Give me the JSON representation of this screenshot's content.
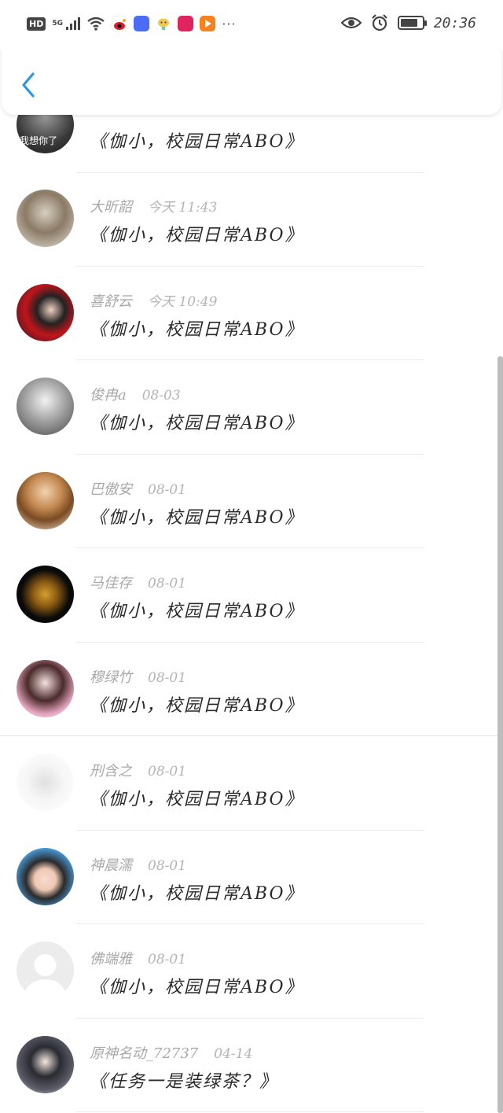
{
  "status_bar": {
    "hd": "HD",
    "network": "5G",
    "time": "20:36",
    "more": "···",
    "battery_level": 0.8,
    "icons": [
      "signal-icon",
      "wifi-icon",
      "weibo-icon",
      "app-blue-icon",
      "wechat-icon",
      "book-icon",
      "video-icon",
      "eye-icon",
      "alarm-icon",
      "battery-icon"
    ]
  },
  "header": {
    "back_icon": "chevron-left-icon"
  },
  "messages": [
    {
      "name": "",
      "time": "",
      "title": "《伽小，校园日常ABO》",
      "avatar_label": "我想你了"
    },
    {
      "name": "大昕韶",
      "time": "今天 11:43",
      "title": "《伽小，校园日常ABO》"
    },
    {
      "name": "喜舒云",
      "time": "今天 10:49",
      "title": "《伽小，校园日常ABO》"
    },
    {
      "name": "俊冉a",
      "time": "08-03",
      "title": "《伽小，校园日常ABO》"
    },
    {
      "name": "巴傲安",
      "time": "08-01",
      "title": "《伽小，校园日常ABO》"
    },
    {
      "name": "马佳存",
      "time": "08-01",
      "title": "《伽小，校园日常ABO》"
    },
    {
      "name": "穆绿竹",
      "time": "08-01",
      "title": "《伽小，校园日常ABO》"
    },
    {
      "name": "刑含之",
      "time": "08-01",
      "title": "《伽小，校园日常ABO》"
    },
    {
      "name": "神晨濡",
      "time": "08-01",
      "title": "《伽小，校园日常ABO》"
    },
    {
      "name": "佛端雅",
      "time": "08-01",
      "title": "《伽小，校园日常ABO》"
    },
    {
      "name": "原神名动_72737",
      "time": "04-14",
      "title": "《任务一是装绿茶？》"
    }
  ],
  "colors": {
    "accent": "#2a97e6",
    "scrollbar": "#bdbdbd"
  }
}
